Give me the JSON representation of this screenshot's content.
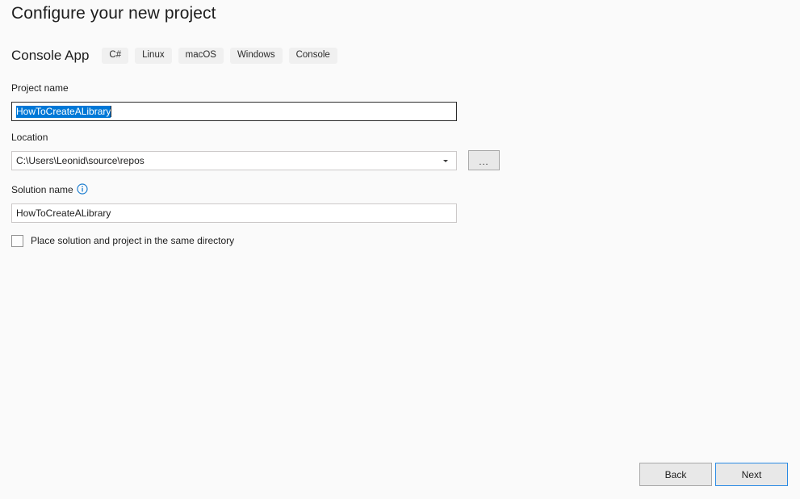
{
  "header": {
    "title": "Configure your new project",
    "template_name": "Console App",
    "tags": [
      "C#",
      "Linux",
      "macOS",
      "Windows",
      "Console"
    ]
  },
  "form": {
    "project_name": {
      "label": "Project name",
      "value": "HowToCreateALibrary",
      "selected": true
    },
    "location": {
      "label": "Location",
      "value": "C:\\Users\\Leonid\\source\\repos",
      "browse_label": "..."
    },
    "solution_name": {
      "label": "Solution name",
      "value": "HowToCreateALibrary",
      "info_icon": "info-circle-icon"
    },
    "same_directory_checkbox": {
      "label": "Place solution and project in the same directory",
      "checked": false
    }
  },
  "footer": {
    "back_label": "Back",
    "next_label": "Next"
  },
  "colors": {
    "background": "#fafafa",
    "selection_blue": "#0078d7",
    "focus_blue": "#2a8ae4",
    "info_blue": "#1f7fd0",
    "tag_background": "#f0f0f0",
    "text": "#1e1e1e"
  }
}
